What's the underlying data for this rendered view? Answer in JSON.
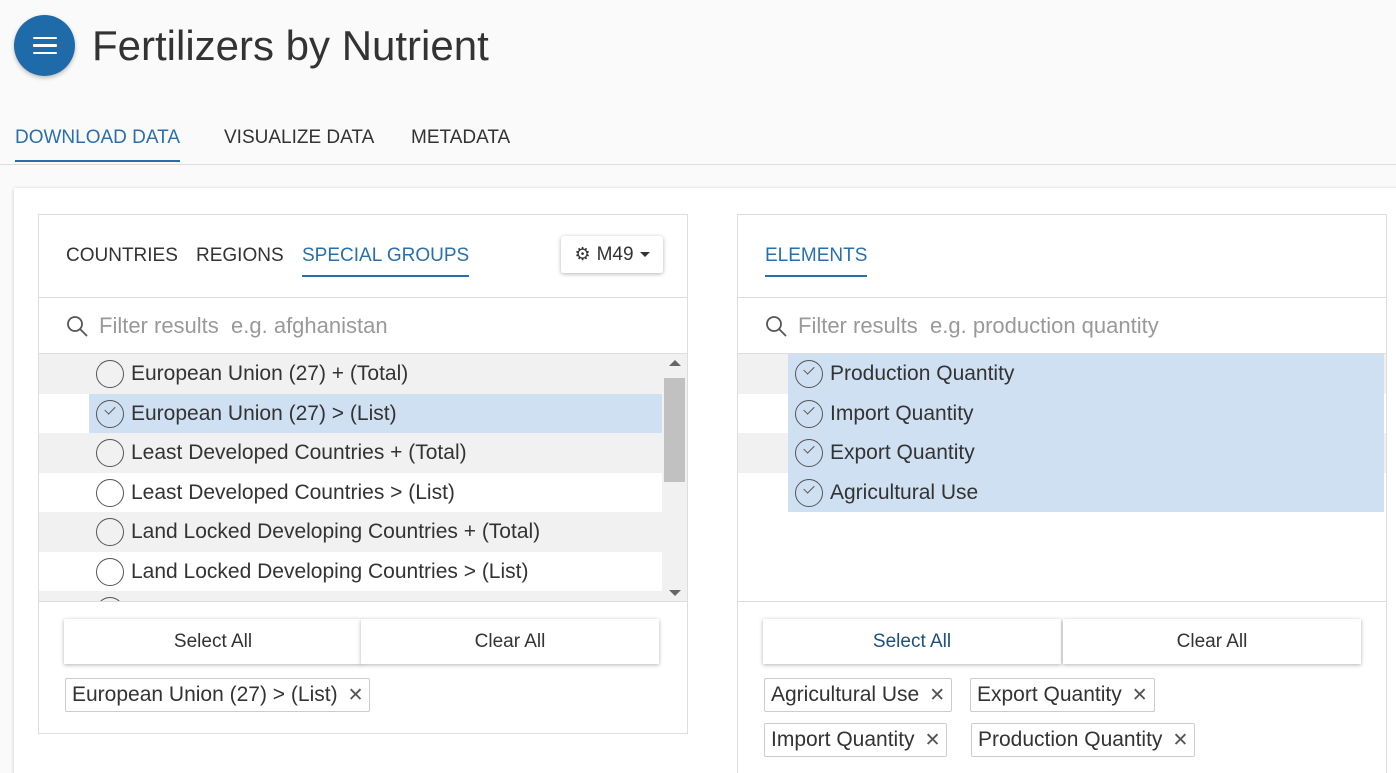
{
  "header": {
    "title": "Fertilizers by Nutrient"
  },
  "main_tabs": [
    "DOWNLOAD DATA",
    "VISUALIZE DATA",
    "METADATA"
  ],
  "left_panel": {
    "tabs": [
      "COUNTRIES",
      "REGIONS",
      "SPECIAL GROUPS"
    ],
    "active_tab": "SPECIAL GROUPS",
    "code_button": "M49",
    "filter_placeholder": "Filter results  e.g. afghanistan",
    "items": [
      {
        "label": "European Union (27) + (Total)",
        "selected": false
      },
      {
        "label": "European Union (27) > (List)",
        "selected": true
      },
      {
        "label": "Least Developed Countries + (Total)",
        "selected": false
      },
      {
        "label": "Least Developed Countries > (List)",
        "selected": false
      },
      {
        "label": "Land Locked Developing Countries + (Total)",
        "selected": false
      },
      {
        "label": "Land Locked Developing Countries > (List)",
        "selected": false
      }
    ],
    "select_all": "Select All",
    "clear_all": "Clear All",
    "chips": [
      "European Union (27) > (List)"
    ]
  },
  "right_panel": {
    "tabs": [
      "ELEMENTS"
    ],
    "active_tab": "ELEMENTS",
    "filter_placeholder": "Filter results  e.g. production quantity",
    "items": [
      {
        "label": "Production Quantity",
        "selected": true
      },
      {
        "label": "Import Quantity",
        "selected": true
      },
      {
        "label": "Export Quantity",
        "selected": true
      },
      {
        "label": "Agricultural Use",
        "selected": true
      }
    ],
    "select_all": "Select All",
    "clear_all": "Clear All",
    "chips": [
      "Agricultural Use",
      "Export Quantity",
      "Import Quantity",
      "Production Quantity"
    ]
  },
  "colors": {
    "accent": "#2a6fad",
    "menu_button": "#1f6aa9",
    "selection": "#cfe0f2"
  },
  "icons": {
    "menu": "hamburger-icon",
    "gear": "gear-icon",
    "search": "search-icon",
    "remove": "close-icon"
  },
  "close_glyph": "✕",
  "gear_glyph": "⚙"
}
